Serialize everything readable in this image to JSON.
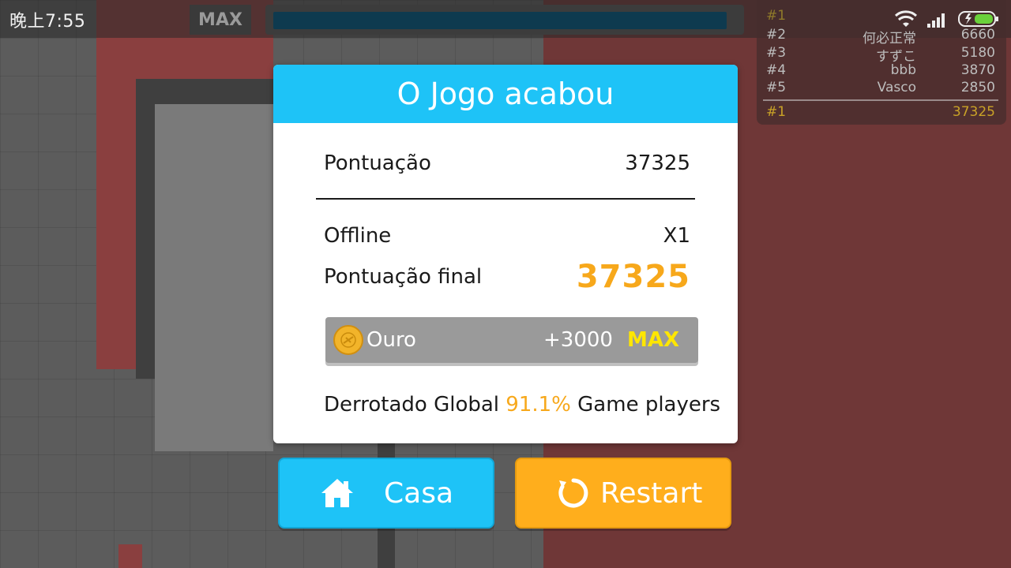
{
  "status_bar": {
    "time": "晚上7:55",
    "max_label": "MAX",
    "progress": 0.98
  },
  "leaderboard": {
    "entries": [
      {
        "rank": "#1",
        "name": "",
        "score": ""
      },
      {
        "rank": "#2",
        "name": "何必正常",
        "score": "6660"
      },
      {
        "rank": "#3",
        "name": "すずこ",
        "score": "5180"
      },
      {
        "rank": "#4",
        "name": "bbb",
        "score": "3870"
      },
      {
        "rank": "#5",
        "name": "Vasco",
        "score": "2850"
      }
    ],
    "self": {
      "rank": "#1",
      "score": "37325"
    }
  },
  "dialog": {
    "title": "O Jogo acabou",
    "score_label": "Pontuação",
    "score_value": "37325",
    "offline_label": "Offline",
    "offline_value": "X1",
    "final_label": "Pontuação final",
    "final_value": "37325",
    "gold": {
      "label": "Ouro",
      "amount": "+3000",
      "max": "MAX"
    },
    "defeat": {
      "prefix": "Derrotado Global ",
      "percent": "91.1%",
      "suffix": " Game players"
    }
  },
  "buttons": {
    "home_label": "Casa",
    "restart_label": "Restart"
  },
  "colors": {
    "accent_blue": "#1ec3f7",
    "accent_orange": "#ffae1c",
    "score_orange": "#f7a81b",
    "max_yellow": "#ffe600"
  }
}
